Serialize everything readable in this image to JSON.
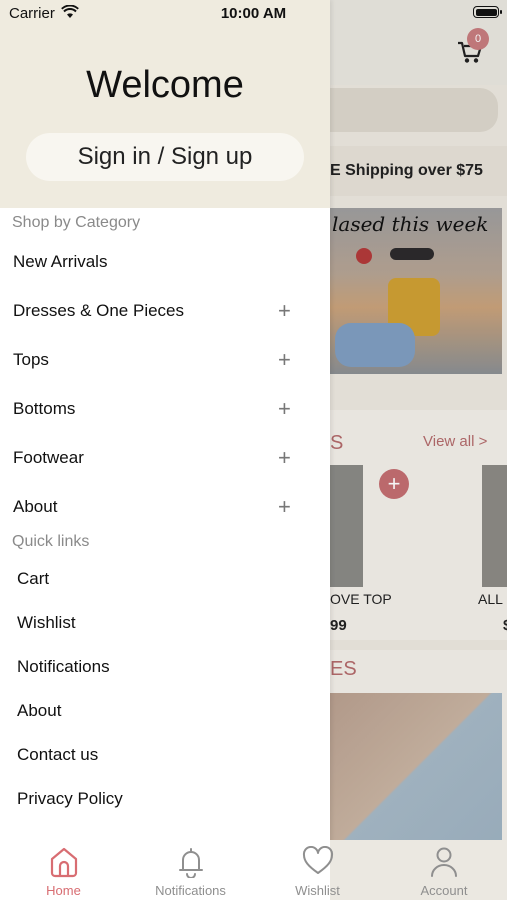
{
  "status": {
    "carrier": "Carrier",
    "time": "10:00 AM"
  },
  "drawer": {
    "welcome": "Welcome",
    "signin_label": "Sign in / Sign up",
    "shop_by_category": "Shop by Category",
    "categories": [
      {
        "label": "New Arrivals",
        "expandable": false
      },
      {
        "label": "Dresses & One Pieces",
        "expandable": true
      },
      {
        "label": "Tops",
        "expandable": true
      },
      {
        "label": "Bottoms",
        "expandable": true
      },
      {
        "label": "Footwear",
        "expandable": true
      },
      {
        "label": "About",
        "expandable": true
      }
    ],
    "quick_links_label": "Quick links",
    "quick_links": [
      "Cart",
      "Wishlist",
      "Notifications",
      "About",
      "Contact us",
      "Privacy Policy"
    ],
    "plus_glyph": "+"
  },
  "background": {
    "cart_badge": "0",
    "shipping_text": "E Shipping over $75",
    "banner_text": "lased this week",
    "section_title": "S",
    "view_all": "View all >",
    "fab_plus": "+",
    "product_1_name": "OVE TOP",
    "product_2_name": "ALL",
    "product_1_price": "99",
    "product_2_price": "$",
    "section2_title": "ES"
  },
  "tabbar": {
    "items": [
      {
        "label": "Home",
        "icon": "home-icon",
        "active": true
      },
      {
        "label": "Notifications",
        "icon": "bell-icon",
        "active": false
      },
      {
        "label": "Wishlist",
        "icon": "heart-icon",
        "active": false
      },
      {
        "label": "Account",
        "icon": "person-icon",
        "active": false
      }
    ]
  },
  "colors": {
    "accent": "#d86d72",
    "drawer_header": "#efebdf",
    "muted": "#8f8f8f"
  }
}
